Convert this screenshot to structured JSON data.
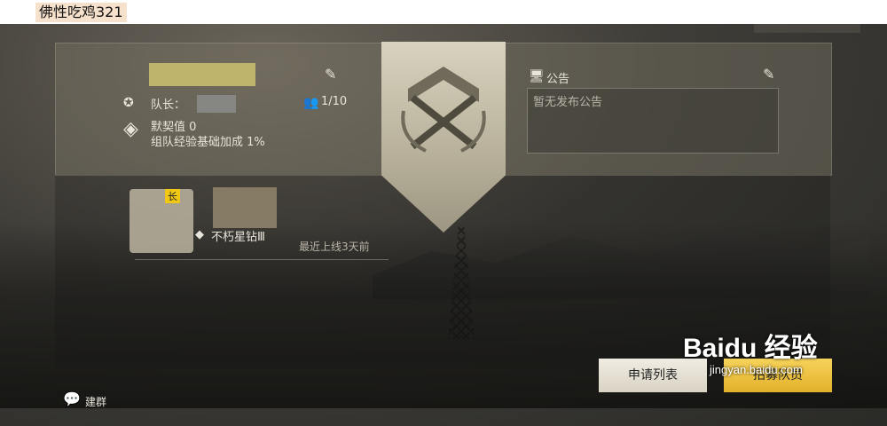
{
  "caption": "佛性吃鸡321",
  "team": {
    "leader_label": "队长：",
    "member_count": "1/10",
    "tacit_label": "默契值 0",
    "exp_bonus_label": "组队经验基础加成 1%"
  },
  "notice": {
    "title": "公告",
    "placeholder": "暂无发布公告"
  },
  "member": {
    "badge": "长",
    "rank": "不朽星钻Ⅲ",
    "last_online": "最近上线3天前"
  },
  "bottom": {
    "create_group": "建群",
    "apply_list": "申请列表",
    "recruit": "招募队员"
  },
  "watermark": {
    "brand": "Baidu 经验",
    "url": "jingyan.baidu.com"
  }
}
